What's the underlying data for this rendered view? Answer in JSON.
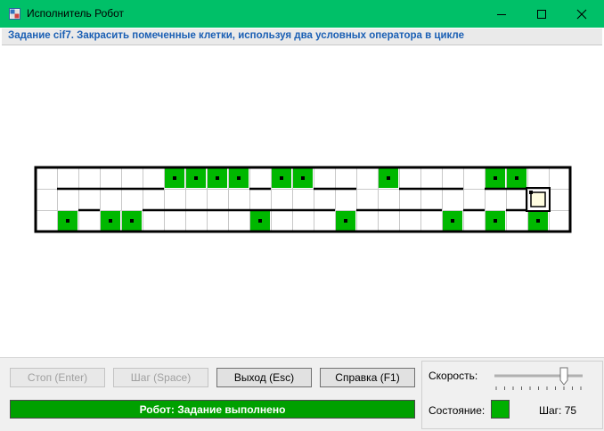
{
  "window": {
    "title": "Исполнитель Робот",
    "icon": "app-grid-icon",
    "controls": [
      "minimize-icon",
      "maximize-icon",
      "close-icon"
    ]
  },
  "task": {
    "text": "Задание cif7. Закрасить помеченные клетки, используя два условных оператора в цикле"
  },
  "field": {
    "rows": 3,
    "cols": 25,
    "fill_color": "#00b800",
    "border_color": "#000000",
    "grid_color": "#c8c8c8",
    "painted_cells": [
      [
        0,
        6
      ],
      [
        0,
        7
      ],
      [
        0,
        8
      ],
      [
        0,
        9
      ],
      [
        0,
        11
      ],
      [
        0,
        12
      ],
      [
        0,
        16
      ],
      [
        0,
        21
      ],
      [
        0,
        22
      ],
      [
        2,
        1
      ],
      [
        2,
        3
      ],
      [
        2,
        4
      ],
      [
        2,
        10
      ],
      [
        2,
        14
      ],
      [
        2,
        19
      ],
      [
        2,
        21
      ],
      [
        2,
        23
      ]
    ],
    "marked_cells": [
      [
        0,
        6
      ],
      [
        0,
        7
      ],
      [
        0,
        8
      ],
      [
        0,
        9
      ],
      [
        0,
        11
      ],
      [
        0,
        12
      ],
      [
        0,
        16
      ],
      [
        0,
        21
      ],
      [
        0,
        22
      ],
      [
        2,
        1
      ],
      [
        2,
        3
      ],
      [
        2,
        4
      ],
      [
        2,
        10
      ],
      [
        2,
        14
      ],
      [
        2,
        19
      ],
      [
        2,
        21
      ],
      [
        2,
        23
      ]
    ],
    "walls_between_rows_0_1": [
      [
        1,
        6
      ],
      [
        10,
        11
      ],
      [
        13,
        15
      ],
      [
        17,
        20
      ],
      [
        21,
        23
      ]
    ],
    "walls_between_rows_1_2": [
      [
        2,
        3
      ],
      [
        5,
        11
      ],
      [
        11,
        14
      ],
      [
        15,
        19
      ],
      [
        20,
        21
      ],
      [
        22,
        23
      ]
    ],
    "robot": {
      "row": 1,
      "col": 23
    }
  },
  "buttons": {
    "stop": "Стоп (Enter)",
    "step": "Шаг (Space)",
    "exit": "Выход (Esc)",
    "help": "Справка (F1)"
  },
  "status": {
    "message": "Робот: Задание выполнено",
    "color": "#00a000"
  },
  "speed": {
    "label": "Скорость:",
    "value_fraction": 0.8,
    "ticks": 11
  },
  "state": {
    "label": "Состояние:",
    "color": "#00b000",
    "step_label": "Шаг: 75"
  }
}
